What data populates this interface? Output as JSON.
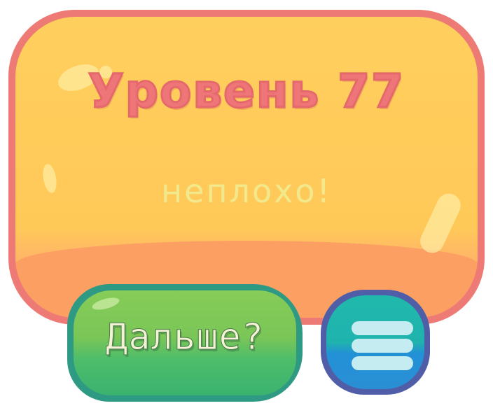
{
  "level_panel": {
    "title": "Уровень 77",
    "subtitle": "неплохо!",
    "fill_color": "#ffc958",
    "border_color": "#ee7a76",
    "title_color": "#ef7678",
    "subtitle_color": "#f2e98d"
  },
  "buttons": {
    "next": {
      "label": "Дальше?",
      "color": "#7ac657",
      "border_color": "#2f9a84"
    },
    "menu": {
      "icon": "hamburger-menu-icon",
      "color": "#20b8ad",
      "border_color": "#4f5ea6"
    }
  }
}
